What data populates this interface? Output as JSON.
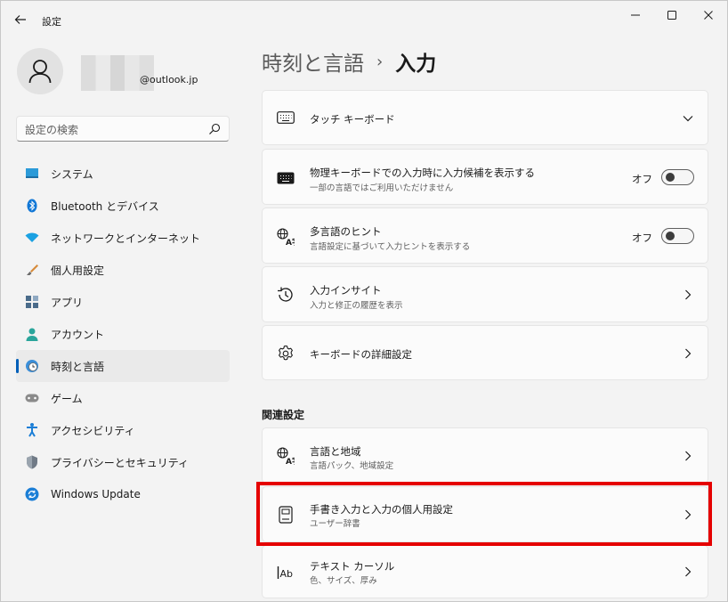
{
  "app": {
    "title": "設定"
  },
  "profile": {
    "email": "@outlook.jp"
  },
  "search": {
    "placeholder": "設定の検索"
  },
  "nav": [
    {
      "label": "システム",
      "icon": "monitor-icon"
    },
    {
      "label": "Bluetooth とデバイス",
      "icon": "bluetooth-icon"
    },
    {
      "label": "ネットワークとインターネット",
      "icon": "wifi-icon"
    },
    {
      "label": "個人用設定",
      "icon": "brush-icon"
    },
    {
      "label": "アプリ",
      "icon": "apps-icon"
    },
    {
      "label": "アカウント",
      "icon": "account-icon"
    },
    {
      "label": "時刻と言語",
      "icon": "clock-globe-icon",
      "active": true
    },
    {
      "label": "ゲーム",
      "icon": "gamepad-icon"
    },
    {
      "label": "アクセシビリティ",
      "icon": "accessibility-icon"
    },
    {
      "label": "プライバシーとセキュリティ",
      "icon": "shield-icon"
    },
    {
      "label": "Windows Update",
      "icon": "update-icon"
    }
  ],
  "breadcrumb": {
    "parent": "時刻と言語",
    "separator": "›",
    "current": "入力"
  },
  "cards": [
    {
      "title": "タッチ キーボード",
      "control": "chevron-down",
      "icon": "keyboard-icon"
    },
    {
      "title": "物理キーボードでの入力時に入力候補を表示する",
      "subtitle": "一部の言語ではご利用いただけません",
      "control": "toggle",
      "toggle_label": "オフ",
      "icon": "keyboard-dark-icon"
    },
    {
      "title": "多言語のヒント",
      "subtitle": "言語設定に基づいて入力ヒントを表示する",
      "control": "toggle",
      "toggle_label": "オフ",
      "icon": "language-icon"
    },
    {
      "title": "入力インサイト",
      "subtitle": "入力と修正の履歴を表示",
      "control": "chevron-right",
      "icon": "history-icon"
    },
    {
      "title": "キーボードの詳細設定",
      "control": "chevron-right",
      "icon": "gear-icon"
    }
  ],
  "related": {
    "label": "関連設定",
    "items": [
      {
        "title": "言語と地域",
        "subtitle": "言語パック、地域設定",
        "icon": "language-icon"
      },
      {
        "title": "手書き入力と入力の個人用設定",
        "subtitle": "ユーザー辞書",
        "icon": "notebook-icon"
      },
      {
        "title": "テキスト カーソル",
        "subtitle": "色、サイズ、厚み",
        "icon": "text-cursor-icon"
      }
    ]
  },
  "colors": {
    "accent": "#005fb8",
    "highlight": "#e50000",
    "background": "#f3f3f3",
    "card": "#fbfbfb"
  }
}
